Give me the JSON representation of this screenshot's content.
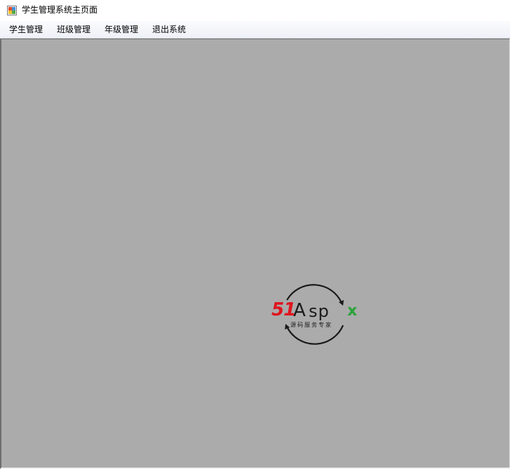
{
  "window": {
    "title": "学生管理系统主页面"
  },
  "menu": {
    "items": [
      {
        "label": "学生管理"
      },
      {
        "label": "班级管理"
      },
      {
        "label": "年级管理"
      },
      {
        "label": "退出系统"
      }
    ]
  },
  "logo": {
    "number": "51",
    "a": "A",
    "sp": "sp",
    "x": "x",
    "subtitle": "源码服务专家",
    "colors": {
      "number": "#e0141e",
      "text": "#1a1a1a",
      "x": "#2aa33a"
    }
  },
  "colors": {
    "mdi_background": "#ababab",
    "menubar": "#eef1f7"
  }
}
